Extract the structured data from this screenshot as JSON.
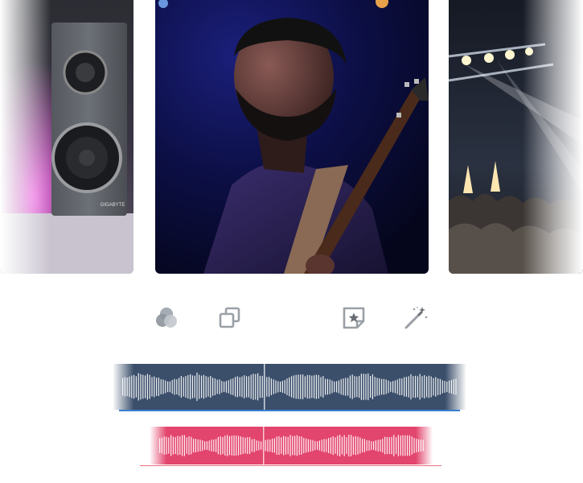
{
  "colors": {
    "track_blue": "#3b4f6b",
    "track_blue_edge": "#3a7fd0",
    "track_pink": "#e2456d",
    "track_pink_edge": "#e9707f",
    "icon_gray": "#9aa0a6",
    "icon_dark": "#6b6f75"
  },
  "photos": [
    {
      "subject": "studio-monitor-speaker",
      "label": "GIGABYTE"
    },
    {
      "subject": "bass-guitarist-on-stage"
    },
    {
      "subject": "concert-crowd-with-stage-lights"
    }
  ],
  "toolbar": {
    "tools": [
      {
        "icon": "color-blend-icon"
      },
      {
        "icon": "duplicate-icon"
      },
      {
        "icon": "sticker-icon"
      },
      {
        "icon": "magic-wand-icon"
      }
    ]
  },
  "tracks": [
    {
      "name": "primary-audio-track",
      "color": "blue",
      "playhead": 0.43
    },
    {
      "name": "secondary-audio-track",
      "color": "pink",
      "playhead": 0.4
    }
  ]
}
